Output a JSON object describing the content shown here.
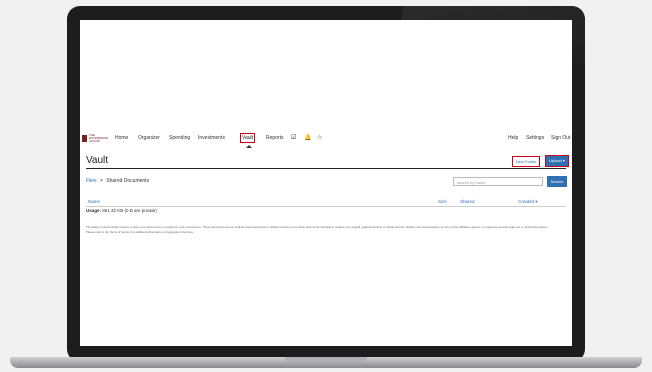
{
  "brand": {
    "logo_text": "THE ENTERPRISE GROUP"
  },
  "nav": {
    "items": [
      "Home",
      "Organizer",
      "Spending",
      "Investments",
      "Vault",
      "Reports"
    ],
    "active": "Vault",
    "icons": [
      "checkbox-icon",
      "bell-icon",
      "star-icon"
    ],
    "right": [
      "Help",
      "Settings",
      "Sign Out"
    ]
  },
  "page": {
    "title": "Vault"
  },
  "actions": {
    "new_folder": "New Folder",
    "upload": "Upload ▾"
  },
  "breadcrumb": {
    "root": "Files",
    "separator": ">",
    "current": "Shared Documents"
  },
  "search": {
    "placeholder": "search by name",
    "button": "Search"
  },
  "table": {
    "columns": [
      "Name",
      "Size",
      "Shared",
      "Created ▾"
    ]
  },
  "usage": {
    "label": "Usage:",
    "value": "861.32 KB (0 B are private)"
  },
  "disclaimer": {
    "line1": "The ability to electronically retrieve or store your documents is provided for your convenience. These documents are not original, legal documents or official records nor are these documents intended to replace your original, legal documents or official records. Neither your representative nor any of their affiliates, agents, or employees provide legal, tax, or accounting advice.",
    "line2": "Please refer to the Terms of Service for additional information on Aggregation Services."
  },
  "colors": {
    "accent": "#2f6fb3",
    "highlight": "#d0021b"
  }
}
